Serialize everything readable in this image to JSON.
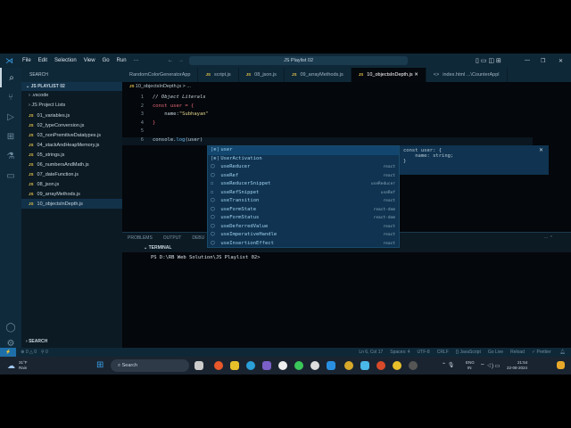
{
  "menu": [
    "File",
    "Edit",
    "Selection",
    "View",
    "Go",
    "Run",
    "···"
  ],
  "command_center": "JS Playlist 02",
  "sidebar": {
    "title": "SEARCH",
    "section": "JS PLAYLIST 02",
    "folders": [
      ".vscode",
      "JS Project Lists"
    ],
    "files": [
      "01_variables.js",
      "02_typeConversion.js",
      "03_nonPremitiveDatatypes.js",
      "04_stackAndHeapMemory.js",
      "05_strings.js",
      "06_numbersAndMath.js",
      "07_dateFunction.js",
      "08_json.js",
      "09_arrayMethods.js",
      "10_objectsInDepth.js"
    ],
    "search_section": "SEARCH"
  },
  "tabs": [
    "RandomColorGeneratorApp",
    "script.js",
    "08_json.js",
    "09_arrayMethods.js",
    "10_objectsInDepth.js",
    "index.html ...\\CounterAppl"
  ],
  "breadcrumb": "10_objectsInDepth.js > ...",
  "code": {
    "l1": "// Object Literals",
    "l2a": "const",
    "l2b": " user = {",
    "l3a": "    name:",
    "l3b": "\"Subhayan\"",
    "l4": "}",
    "l6a": "console.",
    "l6b": "log",
    "l6c": "(user)"
  },
  "suggestions": [
    {
      "label": "user",
      "source": ""
    },
    {
      "label": "UserActivation",
      "source": ""
    },
    {
      "label": "useReducer",
      "source": "react"
    },
    {
      "label": "useRef",
      "source": "react"
    },
    {
      "label": "useReducerSnippet",
      "source": "useReducer"
    },
    {
      "label": "useRefSnippet",
      "source": "useRef"
    },
    {
      "label": "useTransition",
      "source": "react"
    },
    {
      "label": "useFormState",
      "source": "react-dom"
    },
    {
      "label": "useFormStatus",
      "source": "react-dom"
    },
    {
      "label": "useDeferredValue",
      "source": "react"
    },
    {
      "label": "useImperativeHandle",
      "source": "react"
    },
    {
      "label": "useInsertionEffect",
      "source": "react"
    }
  ],
  "detail": "const user: {\n    name: string;\n}",
  "panel": {
    "tabs": [
      "PROBLEMS",
      "OUTPUT",
      "DEBU"
    ],
    "terminal_title": "TERMINAL",
    "prompt": "PS D:\\RB Web Solution\\JS Playlist 02>"
  },
  "status": {
    "errors": "⊗ 0 △ 0",
    "ports": "⚲ 0",
    "position": "Ln 6, Col 17",
    "spaces": "Spaces: 4",
    "encoding": "UTF-8",
    "eol": "CRLF",
    "language": "{} JavaScript",
    "golive": "Go Live",
    "reload": "Reload",
    "prettier": "✓ Prettier"
  },
  "taskbar": {
    "weather_temp": "31°F",
    "weather_desc": "Rain",
    "search": "Search",
    "lang": "ENG",
    "region": "IN",
    "time": "21:54",
    "date": "22-08-2024"
  }
}
